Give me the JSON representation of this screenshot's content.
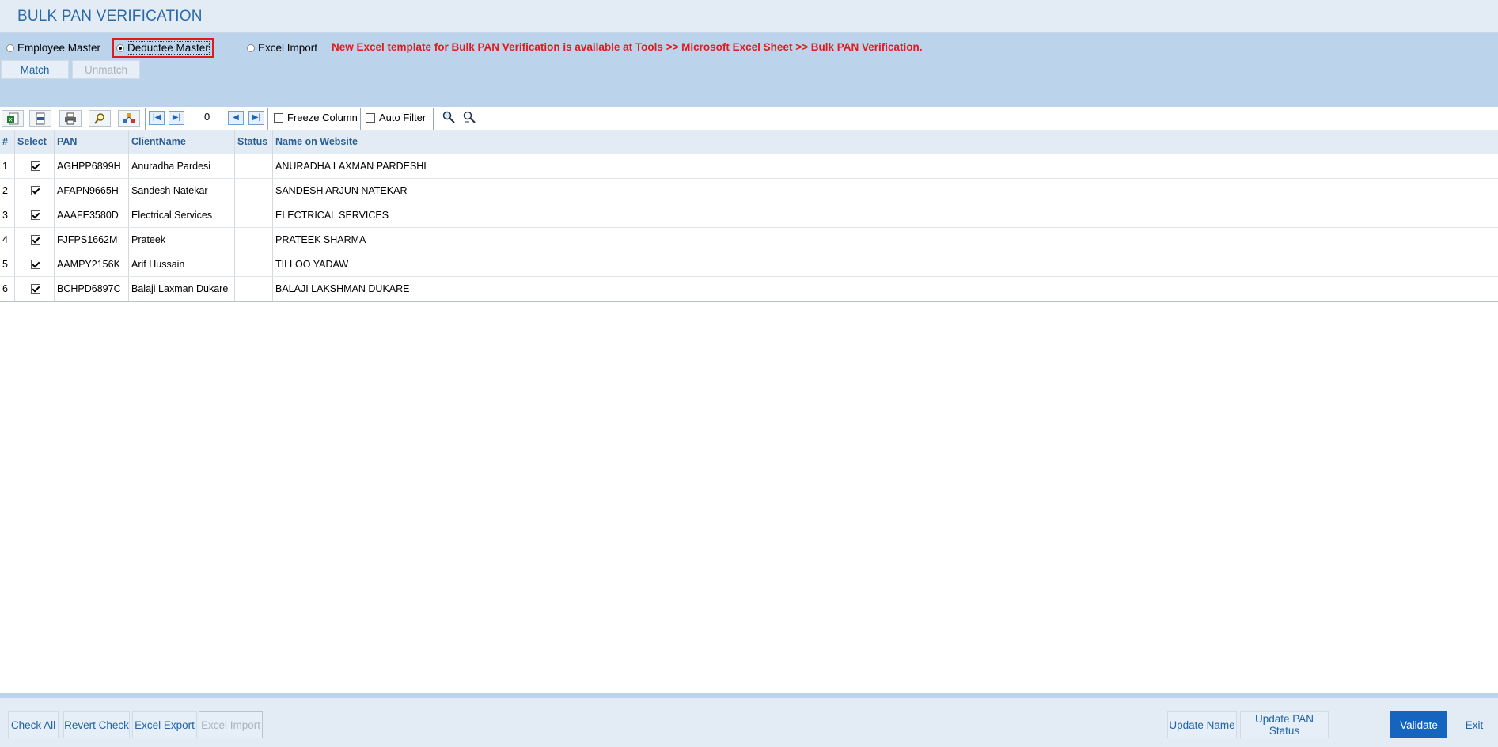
{
  "header": {
    "title": "BULK PAN VERIFICATION"
  },
  "source_options": {
    "employee_master": "Employee Master",
    "deductee_master": "Deductee Master",
    "excel_import": "Excel Import",
    "selected": "Deductee Master"
  },
  "notice": "New Excel template for Bulk PAN Verification is available at Tools >> Microsoft Excel Sheet >> Bulk PAN Verification.",
  "actions": {
    "match": "Match",
    "unmatch": "Unmatch"
  },
  "toolbar": {
    "record_count": "0",
    "freeze_column": "Freeze Column",
    "auto_filter": "Auto Filter",
    "icons": [
      "excel-export-icon",
      "pdf-icon",
      "print-icon",
      "find-icon",
      "columns-icon",
      "first-icon",
      "prev-icon",
      "prev-page-icon",
      "next-page-icon",
      "search-icon",
      "clear-search-icon"
    ]
  },
  "grid": {
    "columns": [
      "#",
      "Select",
      "PAN",
      "ClientName",
      "Status",
      "Name on Website"
    ],
    "rows": [
      {
        "num": "1",
        "pan": "AGHPP6899H",
        "client": "Anuradha Pardesi",
        "status": "",
        "website_name": "ANURADHA LAXMAN PARDESHI",
        "selected": true
      },
      {
        "num": "2",
        "pan": "AFAPN9665H",
        "client": "Sandesh Natekar",
        "status": "",
        "website_name": "SANDESH ARJUN NATEKAR",
        "selected": true
      },
      {
        "num": "3",
        "pan": "AAAFE3580D",
        "client": "Electrical Services",
        "status": "",
        "website_name": "ELECTRICAL SERVICES",
        "selected": true
      },
      {
        "num": "4",
        "pan": "FJFPS1662M",
        "client": "Prateek",
        "status": "",
        "website_name": "PRATEEK SHARMA",
        "selected": true
      },
      {
        "num": "5",
        "pan": "AAMPY2156K",
        "client": "Arif Hussain",
        "status": "",
        "website_name": "TILLOO YADAW",
        "selected": true
      },
      {
        "num": "6",
        "pan": "BCHPD6897C",
        "client": "Balaji Laxman Dukare",
        "status": "",
        "website_name": "BALAJI LAKSHMAN DUKARE",
        "selected": true
      }
    ]
  },
  "footer": {
    "check_all": "Check All",
    "revert_check": "Revert Check",
    "excel_export": "Excel Export",
    "excel_import": "Excel Import",
    "update_name": "Update Name",
    "update_pan_status": "Update PAN Status",
    "validate": "Validate",
    "exit": "Exit"
  },
  "colors": {
    "accent": "#1565c0",
    "notice": "#e01b1b",
    "band": "#bcd3ec"
  }
}
